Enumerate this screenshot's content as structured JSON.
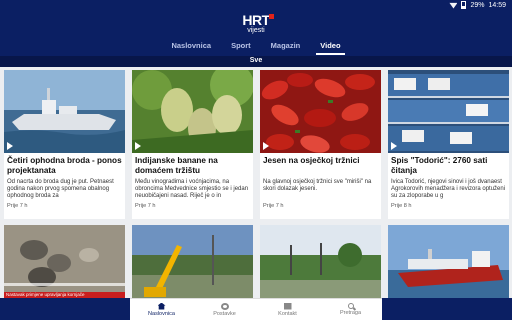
{
  "status": {
    "battery": "29%",
    "time": "14:59"
  },
  "header": {
    "logo_mark": "HRT",
    "logo_sub": "vijesti"
  },
  "tabs": [
    {
      "label": "Naslovnica"
    },
    {
      "label": "Sport"
    },
    {
      "label": "Magazin"
    },
    {
      "label": "Video"
    }
  ],
  "subtabs": {
    "active": "Sve"
  },
  "cards": [
    {
      "title": "Četiri ophodna broda - ponos projektanata",
      "summary": "Od nacrta do broda dug je put. Petnaest godina nakon prvog spomena obalnog ophodnog broda za",
      "time": "Prije 7 h"
    },
    {
      "title": "Indijanske banane na domaćem tržištu",
      "summary": "Među vinogradima i voćnjacima, na obroncima Medvednice smjestio se i jedan neuobičajeni nasad. Riječ je o in",
      "time": "Prije 7 h"
    },
    {
      "title": "Jesen na osječkoj tržnici",
      "summary": "Na glavnoj osječkoj tržnici sve \"miriši\" na skori dolazak jeseni.",
      "time": "Prije 7 h"
    },
    {
      "title": "Spis \"Todorić\": 2760 sati čitanja",
      "summary": "Ivica Todorić, njegovi sinovi i još dvanaest Agrokorovih menadžera i revizora optuženi su za zloporabe u g",
      "time": "Prije 8 h"
    }
  ],
  "ticker_text": "Nastavak primjene upravljanja kornjače",
  "bottom_nav": [
    {
      "label": "Naslovnica"
    },
    {
      "label": "Postavke"
    },
    {
      "label": "Kontakt"
    },
    {
      "label": "Pretraga"
    }
  ],
  "colors": {
    "brand": "#0b1f63",
    "accent": "#e2231a"
  }
}
